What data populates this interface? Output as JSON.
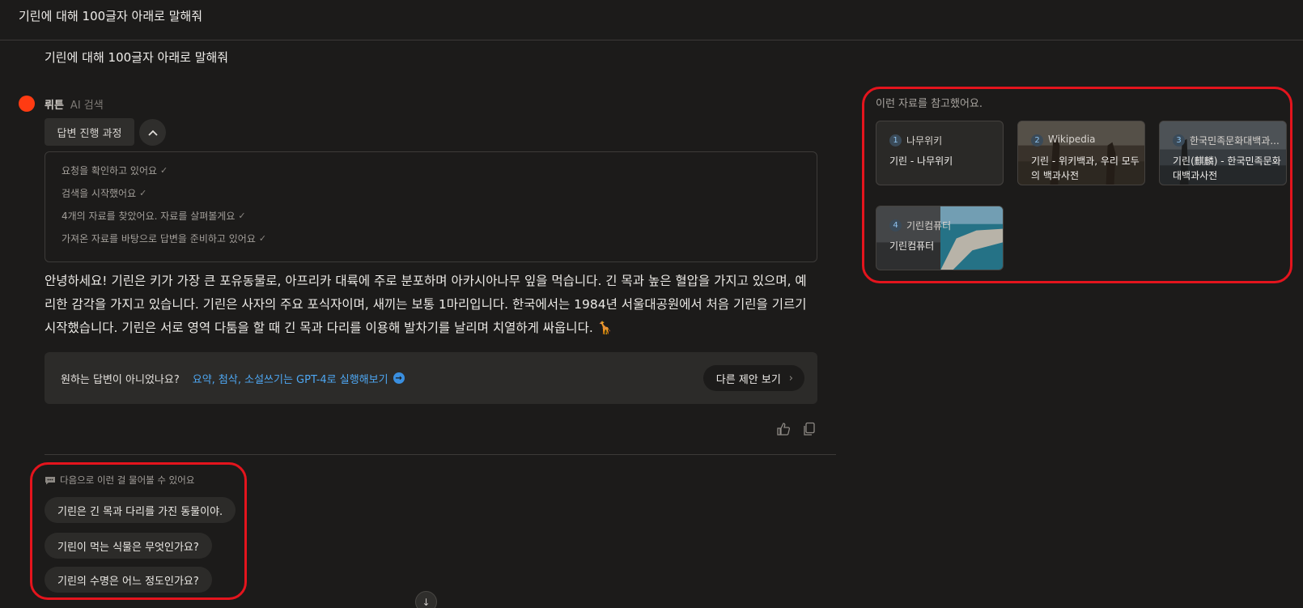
{
  "header": {
    "title": "기린에 대해 100글자 아래로 말해줘"
  },
  "question": "기린에 대해 100글자 아래로 말해줘",
  "bot": {
    "name": "뤼튼",
    "mode": "AI 검색",
    "color": "#ff3b12"
  },
  "process": {
    "button_label": "답변 진행 과정",
    "steps": [
      "요청을 확인하고 있어요",
      "검색을 시작했어요",
      "4개의 자료를 찾았어요. 자료를 살펴볼게요",
      "가져온 자료를 바탕으로 답변을 준비하고 있어요"
    ],
    "check_icon": "check-icon"
  },
  "answer": {
    "text": "안녕하세요! 기린은 키가 가장 큰 포유동물로, 아프리카 대륙에 주로 분포하며 아카시아나무 잎을 먹습니다. 긴 목과 높은 혈압을 가지고 있으며, 예리한 감각을 가지고 있습니다. 기린은 사자의 주요 포식자이며, 새끼는 보통 1마리입니다. 한국에서는 1984년 서울대공원에서 처음 기린을 기르기 시작했습니다. 기린은 서로 영역 다툼을 할 때 긴 목과 다리를 이용해 발차기를 날리며 치열하게 싸웁니다. 🦒"
  },
  "suggestion_banner": {
    "question": "원하는 답변이 아니었나요?",
    "gpt_link": "요약, 첨삭, 소설쓰기는 GPT-4로 실행해보기",
    "other_button": "다른 제안 보기",
    "link_color": "#4ea7f2"
  },
  "followups": {
    "heading": "다음으로 이런 걸 물어볼 수 있어요",
    "items": [
      "기린은 긴 목과 다리를 가진 동물이야.",
      "기린이 먹는 식물은 무엇인가요?",
      "기린의 수명은 어느 정도인가요?"
    ]
  },
  "references": {
    "title": "이런 자료를 참고했어요.",
    "items": [
      {
        "num": "1",
        "source": "나무위키",
        "title": "기린 - 나무위키"
      },
      {
        "num": "2",
        "source": "Wikipedia",
        "title": "기린 - 위키백과, 우리 모두의 백과사전"
      },
      {
        "num": "3",
        "source": "한국민족문화대백과...",
        "title": "기린(麒麟) - 한국민족문화대백과사전"
      },
      {
        "num": "4",
        "source": "기린컴퓨터",
        "title": "기린컴퓨터"
      }
    ]
  },
  "highlight_color": "#e4141d"
}
